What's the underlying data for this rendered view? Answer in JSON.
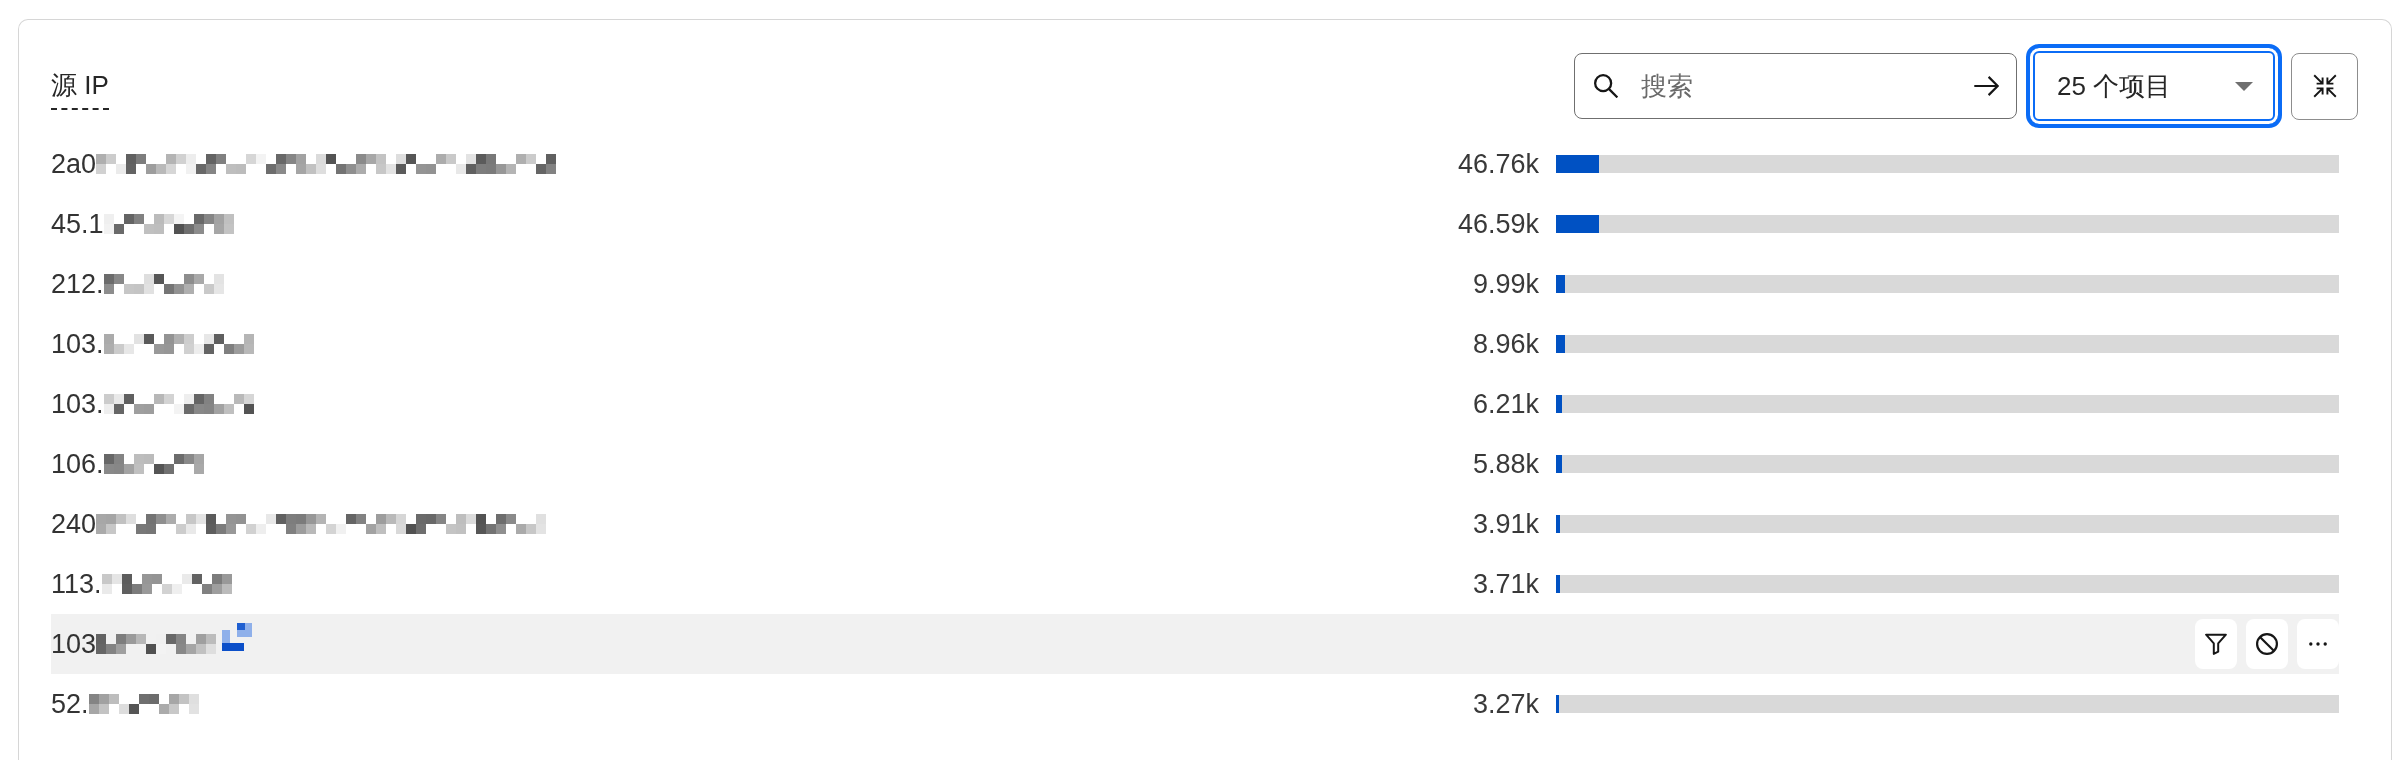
{
  "panel": {
    "title": "源 IP",
    "search": {
      "placeholder": "搜索"
    },
    "item_count": {
      "value": "25 个项目",
      "focused": true
    },
    "rows": [
      {
        "ip": "2a0",
        "value": "46.76k",
        "level": 0.055,
        "hovered": false
      },
      {
        "ip": "45.1",
        "value": "46.59k",
        "level": 0.055,
        "hovered": false
      },
      {
        "ip": "212.",
        "value": "9.99k",
        "level": 0.012,
        "hovered": false
      },
      {
        "ip": "103.",
        "value": "8.96k",
        "level": 0.011,
        "hovered": false
      },
      {
        "ip": "103.",
        "value": "6.21k",
        "level": 0.008,
        "hovered": false
      },
      {
        "ip": "106.",
        "value": "5.88k",
        "level": 0.008,
        "hovered": false
      },
      {
        "ip": "240",
        "value": "3.91k",
        "level": 0.005,
        "hovered": false
      },
      {
        "ip": "113.",
        "value": "3.71k",
        "level": 0.005,
        "hovered": false
      },
      {
        "ip": "103",
        "hovered": true,
        "actions": [
          {
            "kind": "filter"
          },
          {
            "kind": "block"
          },
          {
            "kind": "more"
          }
        ]
      },
      {
        "ip": "52.",
        "value": "3.27k",
        "level": 0.004,
        "hovered": false
      }
    ]
  }
}
